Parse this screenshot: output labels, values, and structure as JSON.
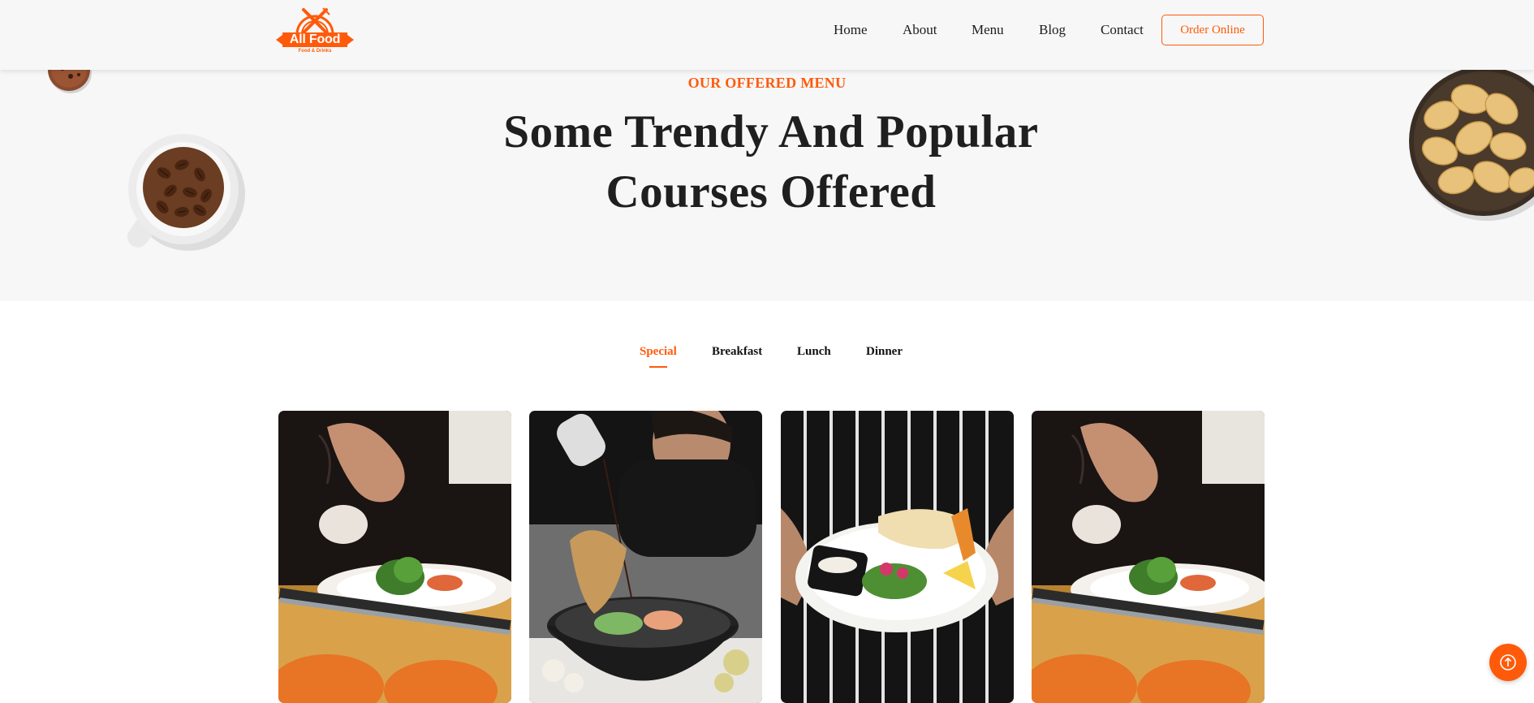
{
  "brand": {
    "name": "All Food",
    "tagline": "Food & Drinks",
    "accent_color": "#ff5a0a"
  },
  "nav": {
    "items": [
      {
        "label": "Home"
      },
      {
        "label": "About"
      },
      {
        "label": "Menu"
      },
      {
        "label": "Blog"
      },
      {
        "label": "Contact"
      }
    ],
    "cta_label": "Order Online"
  },
  "hero": {
    "eyebrow": "OUR OFFERED MENU",
    "title": "Some Trendy And Popular Courses Offered"
  },
  "tabs": [
    {
      "label": "Special",
      "active": true
    },
    {
      "label": "Breakfast",
      "active": false
    },
    {
      "label": "Lunch",
      "active": false
    },
    {
      "label": "Dinner",
      "active": false
    }
  ],
  "cards": [
    {
      "image": "chef-garnishing-plate-photo"
    },
    {
      "image": "chef-saucing-bowl-photo"
    },
    {
      "image": "waiter-holding-fish-plate-photo"
    },
    {
      "image": "chef-garnishing-plate-photo"
    }
  ],
  "icons": {
    "scroll_top": "arrow-up-circle-icon"
  }
}
